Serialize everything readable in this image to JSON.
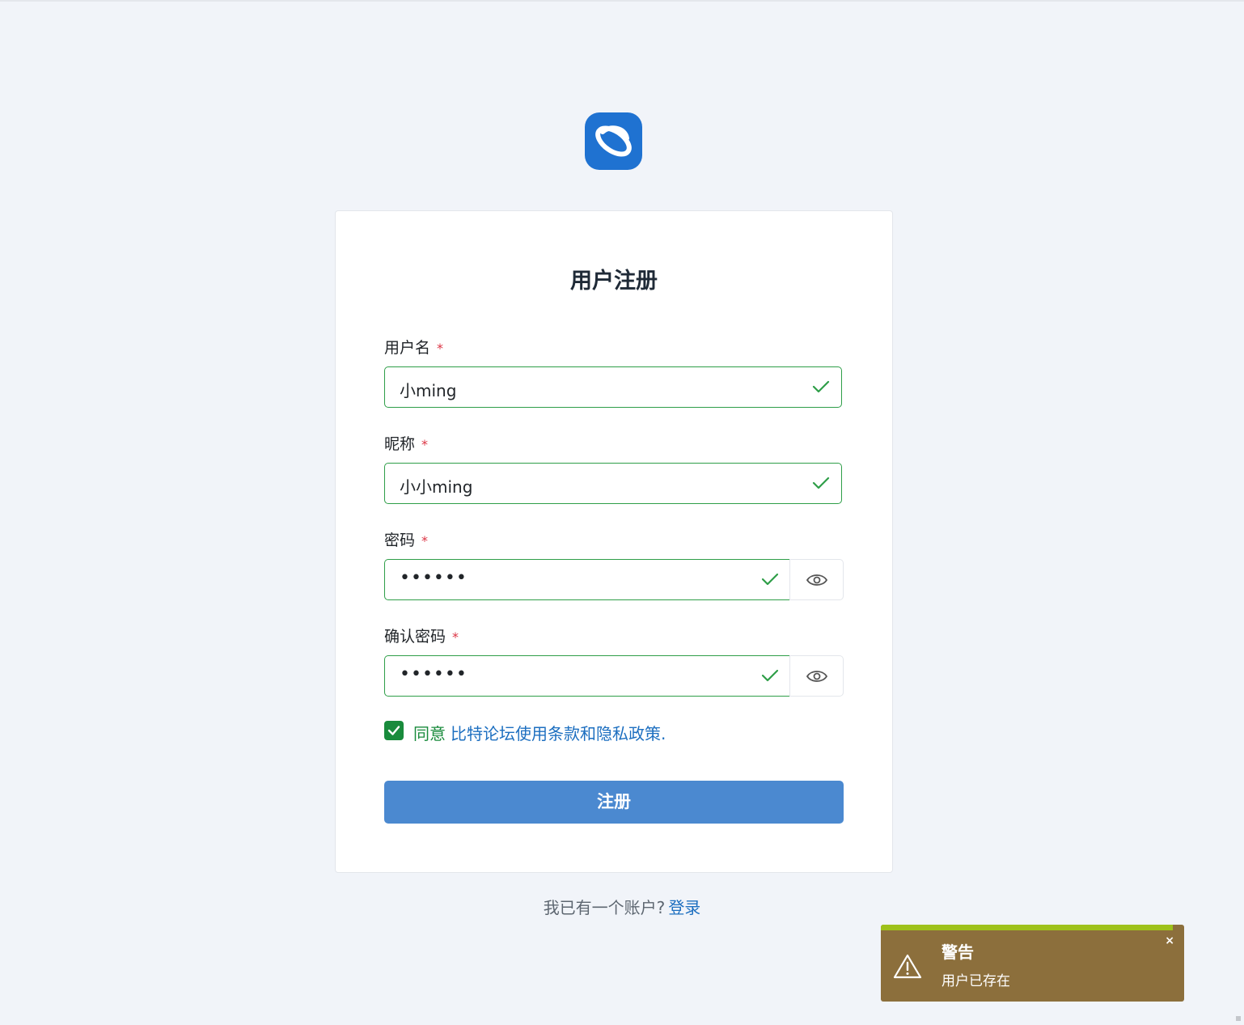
{
  "logo": {
    "icon": "orbit-logo-icon",
    "color": "#1f72d1"
  },
  "form": {
    "title": "用户注册",
    "required_mark": "*",
    "username": {
      "label": "用户名",
      "value": "小ming"
    },
    "nickname": {
      "label": "昵称",
      "value": "小小ming"
    },
    "password": {
      "label": "密码",
      "value": "••••••"
    },
    "confirm_password": {
      "label": "确认密码",
      "value": "••••••"
    },
    "agree": {
      "prefix": "同意",
      "link": "比特论坛使用条款和隐私政策."
    },
    "submit_label": "注册"
  },
  "footer": {
    "text": "我已有一个账户?",
    "login_link": "登录"
  },
  "toast": {
    "title": "警告",
    "message": "用户已存在",
    "close": "×",
    "background": "#8c6f3c",
    "progress_color": "#9ec11b"
  },
  "colors": {
    "valid": "#2e9e48",
    "primary": "#4b89d0",
    "link": "#1d6fc0",
    "required": "#dc3545"
  }
}
